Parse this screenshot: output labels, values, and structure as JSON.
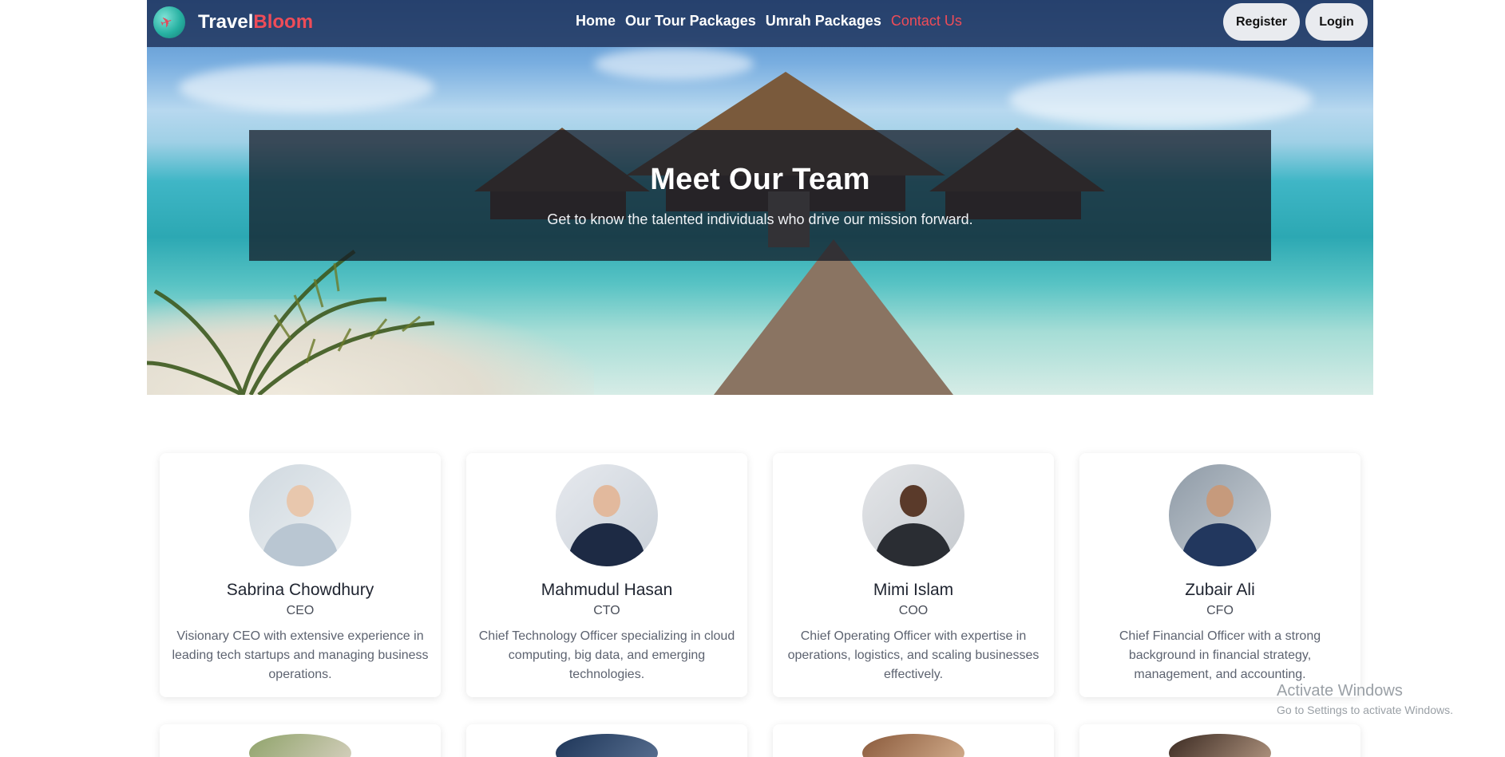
{
  "brand": {
    "name_part1": "Travel",
    "name_part2": "Bloom",
    "logo_icon": "plane-globe-icon"
  },
  "nav": {
    "links": [
      {
        "label": "Home",
        "active": false
      },
      {
        "label": "Our Tour Packages",
        "active": false
      },
      {
        "label": "Umrah Packages",
        "active": false
      },
      {
        "label": "Contact Us",
        "active": true
      }
    ],
    "register_label": "Register",
    "login_label": "Login"
  },
  "hero": {
    "title": "Meet Our Team",
    "subtitle": "Get to know the talented individuals who drive our mission forward."
  },
  "team": [
    {
      "name": "Sabrina Chowdhury",
      "role": "CEO",
      "bio": "Visionary CEO with extensive experience in leading tech startups and managing business operations."
    },
    {
      "name": "Mahmudul Hasan",
      "role": "CTO",
      "bio": "Chief Technology Officer specializing in cloud computing, big data, and emerging technologies."
    },
    {
      "name": "Mimi Islam",
      "role": "COO",
      "bio": "Chief Operating Officer with expertise in operations, logistics, and scaling businesses effectively."
    },
    {
      "name": "Zubair Ali",
      "role": "CFO",
      "bio": "Chief Financial Officer with a strong background in financial strategy, management, and accounting."
    }
  ],
  "watermark": {
    "title": "Activate Windows",
    "subtitle": "Go to Settings to activate Windows."
  },
  "colors": {
    "accent": "#ef4c58",
    "navbar": "#1e325a",
    "overlay": "#141a26"
  }
}
